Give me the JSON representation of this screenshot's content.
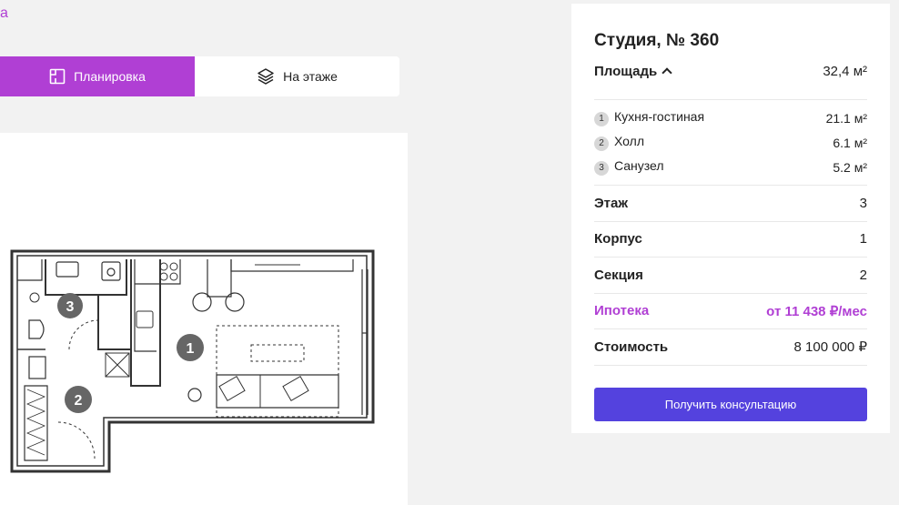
{
  "back": {
    "label": "a"
  },
  "tabs": [
    {
      "label": "Планировка",
      "icon": "floorplan-icon",
      "active": true
    },
    {
      "label": "На этаже",
      "icon": "layers-icon",
      "active": false
    }
  ],
  "plan": {
    "rooms": [
      "1",
      "2",
      "3"
    ]
  },
  "card": {
    "title": "Студия, № 360",
    "area": {
      "label": "Площадь",
      "value": "32,4 м²"
    },
    "rooms": [
      {
        "num": "1",
        "name": "Кухня-гостиная",
        "area": "21.1 м²"
      },
      {
        "num": "2",
        "name": "Холл",
        "area": "6.1 м²"
      },
      {
        "num": "3",
        "name": "Санузел",
        "area": "5.2 м²"
      }
    ],
    "floor": {
      "label": "Этаж",
      "value": "3"
    },
    "building": {
      "label": "Корпус",
      "value": "1"
    },
    "section": {
      "label": "Секция",
      "value": "2"
    },
    "mortgage": {
      "label": "Ипотека",
      "value": "от 11 438 ₽/мес"
    },
    "price": {
      "label": "Стоимость",
      "value": "8 100 000 ₽"
    },
    "cta": "Получить консультацию"
  },
  "colors": {
    "accent": "#b03fd4",
    "cta": "#5442de",
    "background": "#f2f2f2"
  }
}
